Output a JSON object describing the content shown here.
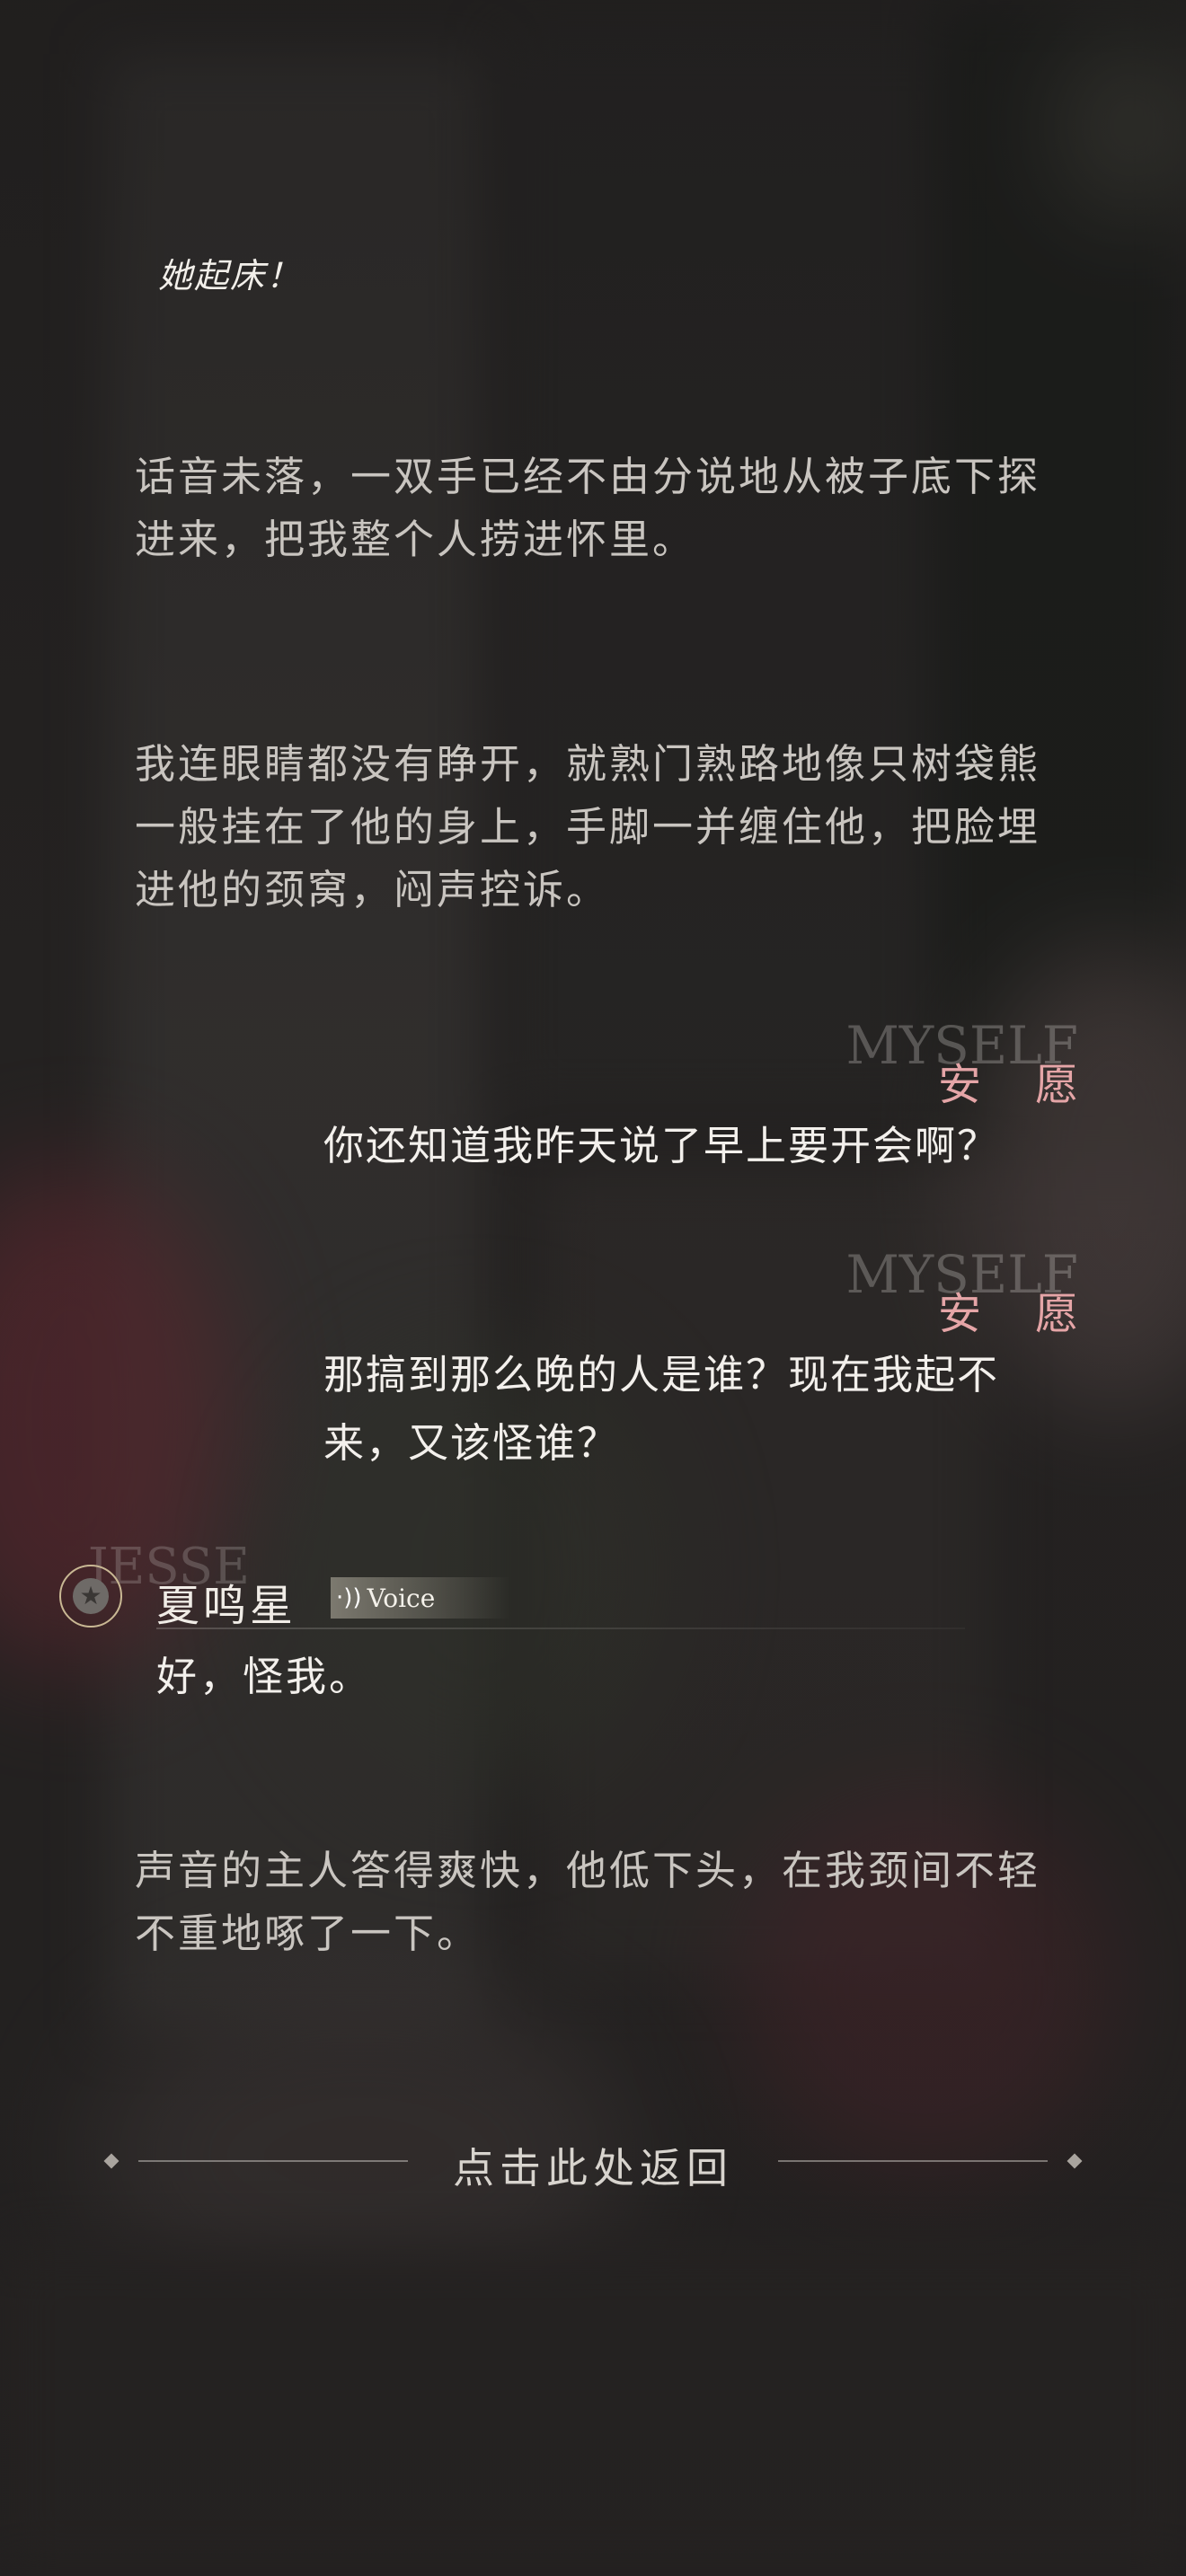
{
  "header": {
    "handwritten_text": "她起床！"
  },
  "narration": [
    "话音未落，一双手已经不由分说地从被子底下探进来，把我整个人捞进怀里。",
    "我连眼睛都没有睁开，就熟门熟路地像只树袋熊一般挂在了他的身上，手脚一并缠住他，把脸埋进他的颈窝，闷声控诉。",
    "声音的主人答得爽快，他低下头，在我颈间不轻不重地啄了一下。"
  ],
  "self_messages": [
    {
      "tag_en": "MYSELF",
      "tag_cn": "安愿",
      "text": "你还知道我昨天说了早上要开会啊？"
    },
    {
      "tag_en": "MYSELF",
      "tag_cn": "安愿",
      "text": "那搞到那么晚的人是谁？现在我起不来，又该怪谁？"
    }
  ],
  "other_message": {
    "tag_en": "JESSE",
    "name": "夏鸣星",
    "voice_label": "Voice",
    "avatar_icon": "star-icon",
    "text": "好，怪我。"
  },
  "footer": {
    "return_label": "点击此处返回"
  },
  "colors": {
    "self_tag": "#e5a5a7",
    "voice_accent": "#dcd6c4",
    "avatar_ring": "#c9b894"
  }
}
